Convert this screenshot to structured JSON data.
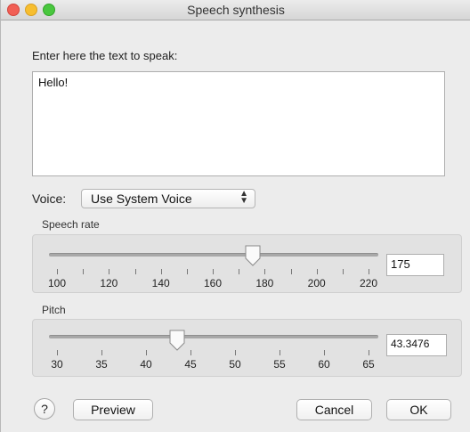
{
  "window": {
    "title": "Speech synthesis"
  },
  "text_prompt": "Enter here the text to speak:",
  "text_value": "Hello!",
  "voice": {
    "label": "Voice:",
    "selected": "Use System Voice"
  },
  "speech_rate": {
    "label": "Speech rate",
    "value": "175",
    "min": 100,
    "max": 220,
    "slider_value": 175,
    "tick_labels": [
      "100",
      "120",
      "140",
      "160",
      "180",
      "200",
      "220"
    ]
  },
  "pitch": {
    "label": "Pitch",
    "value": "43.3476",
    "min": 30,
    "max": 65,
    "slider_value": 43.3476,
    "tick_labels": [
      "30",
      "35",
      "40",
      "45",
      "50",
      "55",
      "60",
      "65"
    ]
  },
  "buttons": {
    "help": "?",
    "preview": "Preview",
    "cancel": "Cancel",
    "ok": "OK"
  }
}
